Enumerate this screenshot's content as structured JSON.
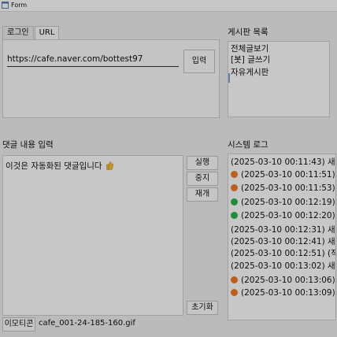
{
  "window": {
    "title": "Form"
  },
  "login_tabs": [
    "로그인",
    "URL"
  ],
  "url_panel": {
    "url_value": "https://cafe.naver.com/bottest97",
    "input_button": "입력"
  },
  "board_panel": {
    "title": "게시판 목록",
    "items": [
      "전체글보기",
      "[봇] 글쓰기",
      "자유게시판"
    ]
  },
  "comment_panel": {
    "title": "댓글 내용 입력",
    "text": "이것은 자동화된 댓글입니다",
    "buttons": {
      "run": "실행",
      "stop": "중지",
      "resume": "재개",
      "reset": "초기화"
    },
    "emoticon_button": "이모티콘",
    "emoticon_file": "cafe_001-24-185-160.gif"
  },
  "system_log": {
    "title": "시스템 로그",
    "lines": [
      {
        "dot": "none",
        "text": "(2025-03-10 00:11:43) 새로운 게시"
      },
      {
        "dot": "orange",
        "text": "(2025-03-10 00:11:51): 작업 중"
      },
      {
        "dot": "orange",
        "text": "(2025-03-10 00:11:53): 초기화"
      },
      {
        "dot": "green",
        "text": "(2025-03-10 00:12:19) 전체글보"
      },
      {
        "dot": "green",
        "text": "(2025-03-10 00:12:20) 자유게시"
      },
      {
        "dot": "none",
        "text": "(2025-03-10 00:12:31) 새로운 게"
      },
      {
        "dot": "none",
        "text": "(2025-03-10 00:12:41) 새로운 게"
      },
      {
        "dot": "none",
        "text": "(2025-03-10 00:12:51) (작성 완료!"
      },
      {
        "dot": "none",
        "text": "(2025-03-10 00:13:02) 새로운 게시"
      },
      {
        "dot": "orange",
        "text": "(2025-03-10 00:13:06): 작업 중"
      },
      {
        "dot": "orange",
        "text": "(2025-03-10 00:13:09): 초기화"
      }
    ]
  },
  "colors": {
    "dot_orange": "#f07a2a",
    "dot_green": "#2bb44a",
    "selection": "#7aa7d8"
  }
}
